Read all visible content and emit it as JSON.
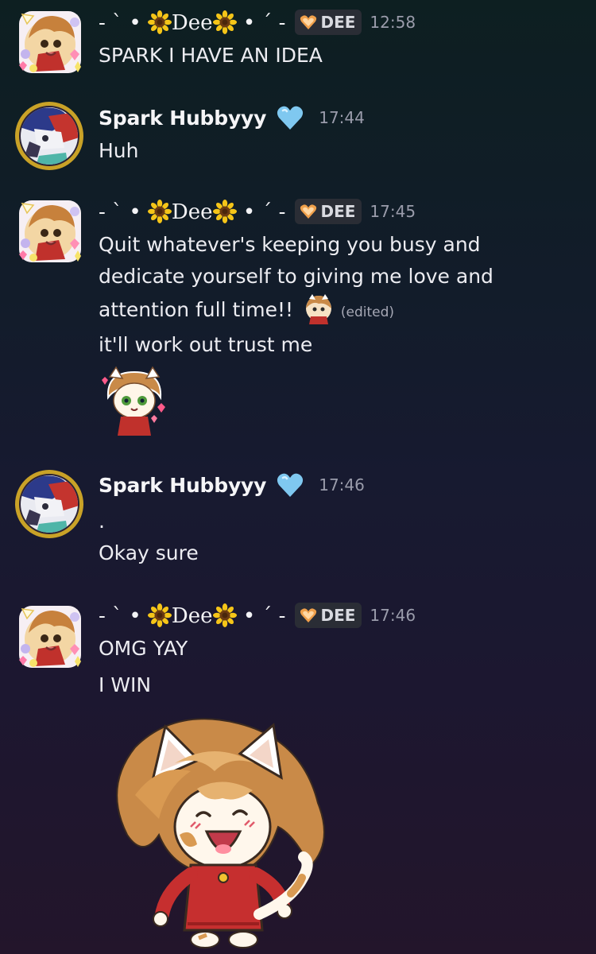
{
  "messages": [
    {
      "author": "Dee",
      "name_prefix": "- ` •",
      "name_core": "Dee",
      "name_suffix": "• ´ -",
      "tag": "DEE",
      "time": "12:58",
      "lines": [
        "SPARK I HAVE AN IDEA"
      ]
    },
    {
      "author": "Spark Hubbyyy",
      "time": "17:44",
      "lines": [
        "Huh"
      ]
    },
    {
      "author": "Dee",
      "name_prefix": "- ` •",
      "name_core": "Dee",
      "name_suffix": "• ´ -",
      "tag": "DEE",
      "time": "17:45",
      "lines": [
        "Quit whatever's keeping you busy and",
        "dedicate yourself to giving me love and",
        "attention full time!!",
        "it'll work out trust me"
      ],
      "edited_label": "(edited)"
    },
    {
      "author": "Spark Hubbyyy",
      "time": "17:46",
      "lines": [
        ".",
        "Okay sure"
      ]
    },
    {
      "author": "Dee",
      "name_prefix": "- ` •",
      "name_core": "Dee",
      "name_suffix": "• ´ -",
      "tag": "DEE",
      "time": "17:46",
      "lines": [
        "OMG YAY",
        "I WIN"
      ]
    }
  ],
  "icons": {
    "dee_name_decoration": "sunflower-icon",
    "dee_tag": "orange-heart-icon",
    "spark_badge": "blue-heart-icon",
    "emoji": "cat-girl-emoji",
    "sticker_small": "cat-girl-hearts-sticker",
    "sticker_large": "cat-girl-cheering-sticker"
  },
  "colors": {
    "tag_heart": "#f0a04b",
    "blue_heart": "#7fc8f0",
    "avatar_ring": "#c9a227"
  }
}
